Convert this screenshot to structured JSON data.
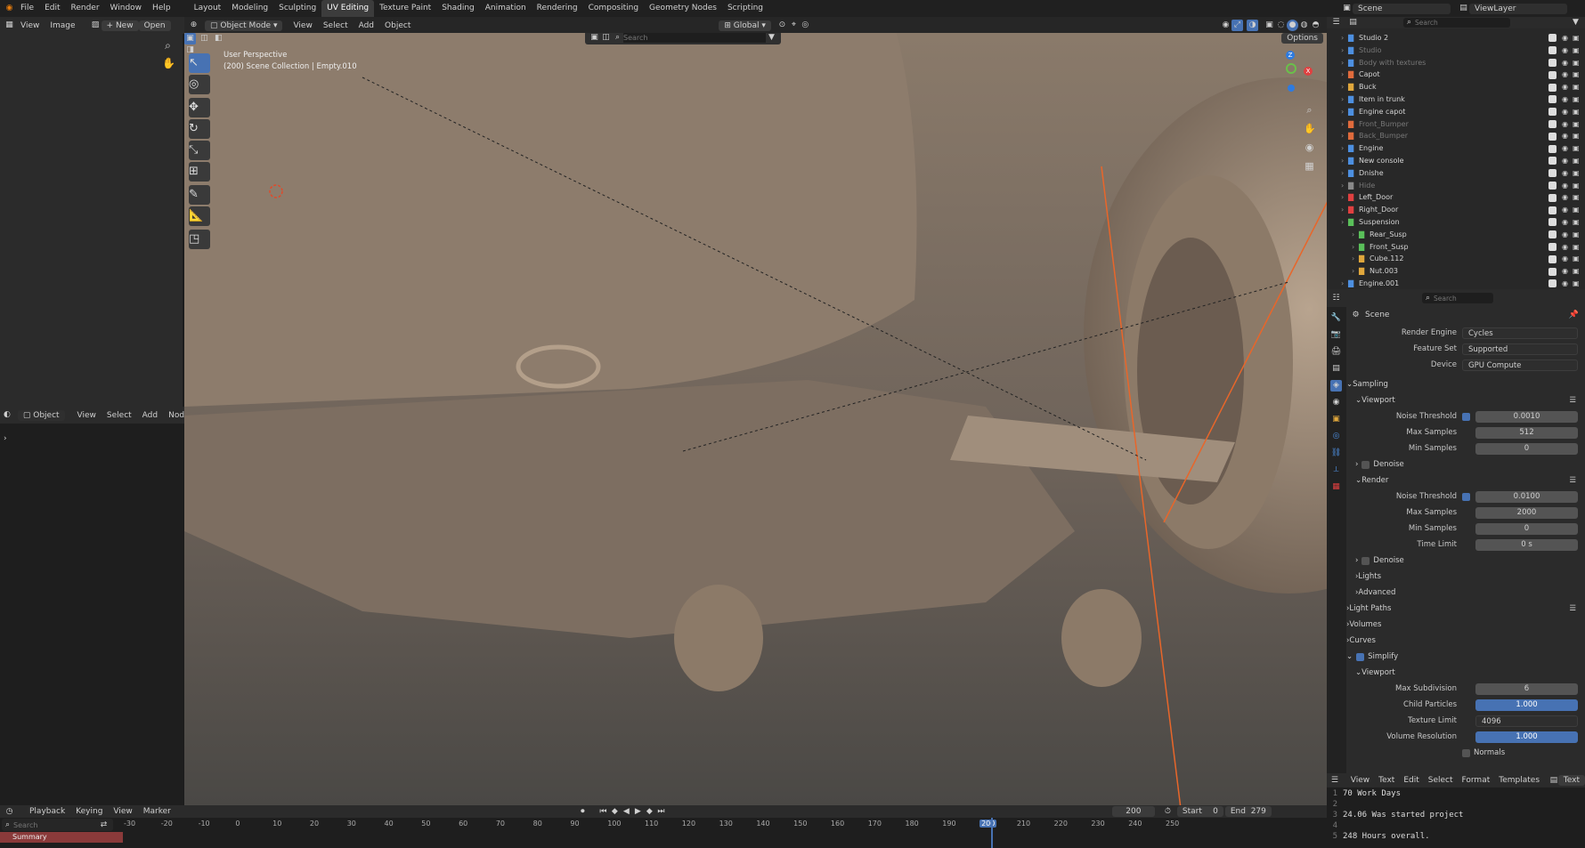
{
  "topbar": {
    "menus": [
      "File",
      "Edit",
      "Render",
      "Window",
      "Help"
    ],
    "workspaces": [
      "Layout",
      "Modeling",
      "Sculpting",
      "UV Editing",
      "Texture Paint",
      "Shading",
      "Animation",
      "Rendering",
      "Compositing",
      "Geometry Nodes",
      "Scripting"
    ],
    "active_workspace": "UV Editing",
    "scene_name": "Scene",
    "view_layer": "ViewLayer"
  },
  "uv_editor": {
    "menus": [
      "View",
      "Image"
    ],
    "new_label": "New",
    "open_label": "Open"
  },
  "node_editor": {
    "mode": "Object",
    "menus": [
      "View",
      "Select",
      "Add",
      "Node"
    ]
  },
  "viewport": {
    "mode": "Object Mode",
    "menus": [
      "View",
      "Select",
      "Add",
      "Object"
    ],
    "orientation": "Global",
    "search_placeholder": "Search",
    "options_label": "Options",
    "overlay_title": "User Perspective",
    "overlay_subtitle": "(200) Scene Collection | Empty.010"
  },
  "outliner": {
    "search_placeholder": "Search",
    "items": [
      {
        "name": "Studio 2",
        "color": "#4d8fe0",
        "dim": false,
        "indent": 0
      },
      {
        "name": "Studio",
        "color": "#4d8fe0",
        "dim": true,
        "indent": 0
      },
      {
        "name": "Body with textures",
        "color": "#4d8fe0",
        "dim": true,
        "indent": 0
      },
      {
        "name": "Capot",
        "color": "#e06b3c",
        "dim": false,
        "indent": 0
      },
      {
        "name": "Buck",
        "color": "#e0a73c",
        "dim": false,
        "indent": 0
      },
      {
        "name": "Item in trunk",
        "color": "#4d8fe0",
        "dim": false,
        "indent": 0
      },
      {
        "name": "Engine capot",
        "color": "#4d8fe0",
        "dim": false,
        "indent": 0
      },
      {
        "name": "Front_Bumper",
        "color": "#e06b3c",
        "dim": true,
        "indent": 0
      },
      {
        "name": "Back_Bumper",
        "color": "#e06b3c",
        "dim": true,
        "indent": 0
      },
      {
        "name": "Engine",
        "color": "#4d8fe0",
        "dim": false,
        "indent": 0
      },
      {
        "name": "New console",
        "color": "#4d8fe0",
        "dim": false,
        "indent": 0
      },
      {
        "name": "Dnishe",
        "color": "#4d8fe0",
        "dim": false,
        "indent": 0
      },
      {
        "name": "Hide",
        "color": "#888",
        "dim": true,
        "indent": 0
      },
      {
        "name": "Left_Door",
        "color": "#e04040",
        "dim": false,
        "indent": 0
      },
      {
        "name": "Right_Door",
        "color": "#e04040",
        "dim": false,
        "indent": 0
      },
      {
        "name": "Suspension",
        "color": "#5ac05a",
        "dim": false,
        "indent": 0
      },
      {
        "name": "Rear_Susp",
        "color": "#5ac05a",
        "dim": false,
        "indent": 1
      },
      {
        "name": "Front_Susp",
        "color": "#5ac05a",
        "dim": false,
        "indent": 1
      },
      {
        "name": "Cube.112",
        "color": "#e0a73c",
        "dim": false,
        "indent": 1
      },
      {
        "name": "Nut.003",
        "color": "#e0a73c",
        "dim": false,
        "indent": 1
      },
      {
        "name": "Engine.001",
        "color": "#4d8fe0",
        "dim": false,
        "indent": 0
      }
    ]
  },
  "properties": {
    "search_placeholder": "Search",
    "context": "Scene",
    "render_engine": {
      "label": "Render Engine",
      "value": "Cycles"
    },
    "feature_set": {
      "label": "Feature Set",
      "value": "Supported"
    },
    "device": {
      "label": "Device",
      "value": "GPU Compute"
    },
    "sampling": "Sampling",
    "viewport_sub": "Viewport",
    "vp_noise": {
      "label": "Noise Threshold",
      "value": "0.0010"
    },
    "vp_max": {
      "label": "Max Samples",
      "value": "512"
    },
    "vp_min": {
      "label": "Min Samples",
      "value": "0"
    },
    "denoise": "Denoise",
    "render_sub": "Render",
    "r_noise": {
      "label": "Noise Threshold",
      "value": "0.0100"
    },
    "r_max": {
      "label": "Max Samples",
      "value": "2000"
    },
    "r_min": {
      "label": "Min Samples",
      "value": "0"
    },
    "r_time": {
      "label": "Time Limit",
      "value": "0 s"
    },
    "denoise2": "Denoise",
    "lights": "Lights",
    "advanced": "Advanced",
    "light_paths": "Light Paths",
    "volumes": "Volumes",
    "curves": "Curves",
    "simplify": "Simplify",
    "simplify_viewport": "Viewport",
    "max_subdiv": {
      "label": "Max Subdivision",
      "value": "6"
    },
    "child_particles": {
      "label": "Child Particles",
      "value": "1.000"
    },
    "texture_limit": {
      "label": "Texture Limit",
      "value": "4096"
    },
    "volume_res": {
      "label": "Volume Resolution",
      "value": "1.000"
    },
    "normals": "Normals"
  },
  "text_editor": {
    "menus": [
      "View",
      "Text",
      "Edit",
      "Select",
      "Format",
      "Templates"
    ],
    "text_label": "Text",
    "lines": [
      {
        "n": "1",
        "t": "70 Work Days"
      },
      {
        "n": "2",
        "t": ""
      },
      {
        "n": "3",
        "t": "24.06 Was started project"
      },
      {
        "n": "4",
        "t": ""
      },
      {
        "n": "5",
        "t": "248 Hours overall."
      }
    ]
  },
  "timeline": {
    "menus": [
      "Playback",
      "Keying",
      "View",
      "Marker"
    ],
    "current_frame": "200",
    "start_label": "Start",
    "start": "0",
    "end_label": "End",
    "end": "279",
    "search_placeholder": "Search",
    "summary_label": "Summary",
    "ticks": [
      "-30",
      "-20",
      "-10",
      "0",
      "10",
      "20",
      "30",
      "40",
      "50",
      "60",
      "70",
      "80",
      "90",
      "100",
      "110",
      "120",
      "130",
      "140",
      "150",
      "160",
      "170",
      "180",
      "190",
      "200",
      "210",
      "220",
      "230",
      "240",
      "250"
    ]
  }
}
